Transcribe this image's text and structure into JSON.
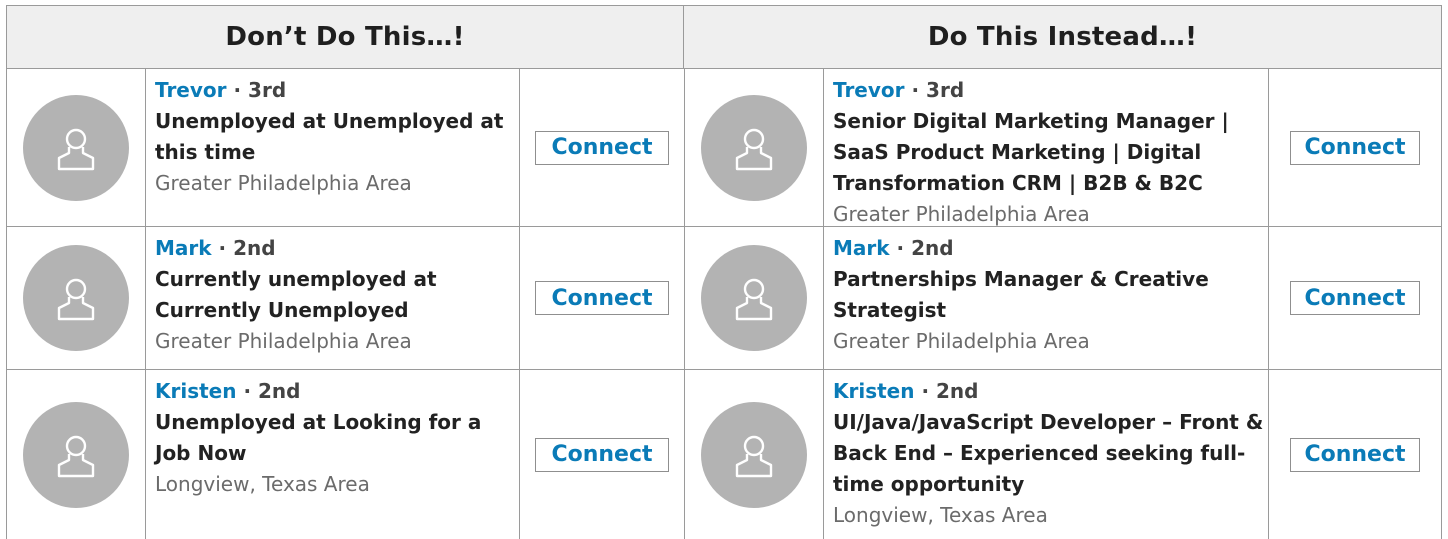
{
  "columns": [
    {
      "heading": "Don’t Do This…!",
      "people": [
        {
          "name": "Trevor",
          "degree": " · 3rd",
          "title": "Unemployed at Unemployed at this time",
          "location": "Greater Philadelphia Area",
          "action": "Connect"
        },
        {
          "name": "Mark",
          "degree": " · 2nd",
          "title": "Currently unemployed at Currently Unemployed",
          "location": "Greater Philadelphia Area",
          "action": "Connect"
        },
        {
          "name": "Kristen",
          "degree": " · 2nd",
          "title": "Unemployed at Looking for a Job Now",
          "location": "Longview, Texas Area",
          "action": "Connect"
        }
      ]
    },
    {
      "heading": "Do This Instead…!",
      "people": [
        {
          "name": "Trevor",
          "degree": " · 3rd",
          "title": "Senior Digital Marketing Manager | SaaS Product Marketing | Digital Transformation CRM | B2B & B2C",
          "location": "Greater Philadelphia Area",
          "action": "Connect"
        },
        {
          "name": "Mark",
          "degree": " · 2nd",
          "title": "Partnerships Manager & Creative Strategist",
          "location": "Greater Philadelphia Area",
          "action": "Connect"
        },
        {
          "name": "Kristen",
          "degree": " · 2nd",
          "title": "UI/Java/JavaScript Developer – Front & Back End – Experienced seeking full-time opportunity",
          "location": "Longview, Texas Area",
          "action": "Connect"
        }
      ]
    }
  ],
  "colors": {
    "name": "#0a7bb7",
    "avatar": "#b3b3b3",
    "header_bg": "#efefef",
    "border": "#9a9a9a"
  },
  "icons": {
    "avatar": "person-outline-icon"
  }
}
